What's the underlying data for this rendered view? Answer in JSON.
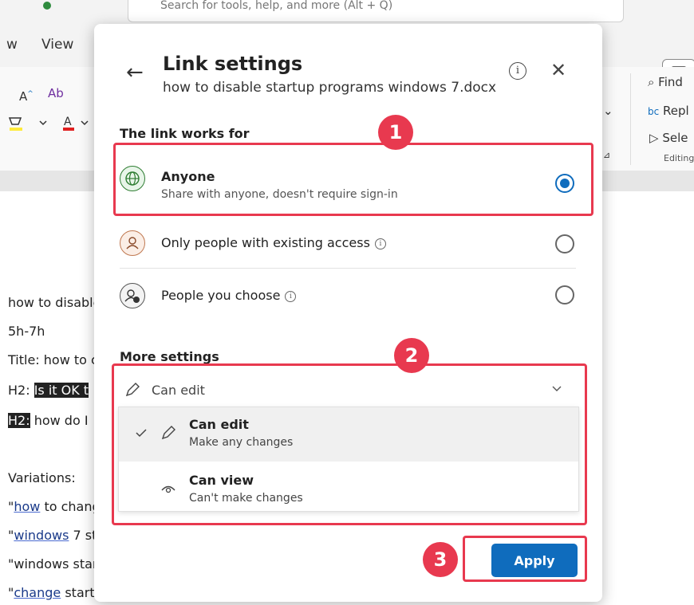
{
  "background": {
    "search_text": "Search for tools, help, and more (Alt + Q)",
    "menu": [
      "w",
      "View"
    ],
    "ribbon": {
      "font_grow": "A",
      "find": "Find",
      "replace": "Repl",
      "select": "Sele",
      "editing": "Editing"
    },
    "doc_lines": [
      {
        "pre": "",
        "hl": "",
        "link": "",
        "text": "how to disable"
      },
      {
        "pre": "",
        "hl": "",
        "link": "",
        "text": "5h-7h"
      },
      {
        "pre": "",
        "hl": "",
        "link": "",
        "text": "Title: how to c"
      },
      {
        "pre": "H2: ",
        "hl": "Is it OK t",
        "link": "",
        "text": ""
      },
      {
        "pre": "",
        "hl": "H2:",
        "link": "",
        "text": " how do I"
      },
      {
        "pre": "",
        "hl": "",
        "link": "",
        "text": "Variations:"
      },
      {
        "pre": "\"",
        "hl": "",
        "link": "how",
        "text": " to chang"
      },
      {
        "pre": "\"",
        "hl": "",
        "link": "windows",
        "text": " 7 st"
      },
      {
        "pre": "",
        "hl": "",
        "link": "",
        "text": "\"windows star"
      },
      {
        "pre": "\"",
        "hl": "",
        "link": "change",
        "text": " startu"
      }
    ]
  },
  "dialog": {
    "title": "Link settings",
    "subtitle": "how to disable startup programs windows 7.docx",
    "info_glyph": "i",
    "close_glyph": "✕",
    "back_glyph": "←",
    "section_link": "The link works for",
    "options": [
      {
        "title": "Anyone",
        "subtitle": "Share with anyone, doesn't require sign-in",
        "selected": true,
        "icon": "globe-icon",
        "info": false
      },
      {
        "title": "Only people with existing access",
        "subtitle": "",
        "selected": false,
        "icon": "person-icon",
        "info": true
      },
      {
        "title": "People you choose",
        "subtitle": "",
        "selected": false,
        "icon": "people-icon",
        "info": true
      }
    ],
    "section_more": "More settings",
    "permission_current": "Can edit",
    "permission_options": [
      {
        "title": "Can edit",
        "subtitle": "Make any changes",
        "selected": true,
        "icon": "pencil-icon"
      },
      {
        "title": "Can view",
        "subtitle": "Can't make changes",
        "selected": false,
        "icon": "eye-icon"
      }
    ],
    "apply_label": "Apply"
  },
  "annotations": [
    "1",
    "2",
    "3"
  ],
  "colors": {
    "accent": "#0f6cbd",
    "annotation": "#e8394f"
  }
}
